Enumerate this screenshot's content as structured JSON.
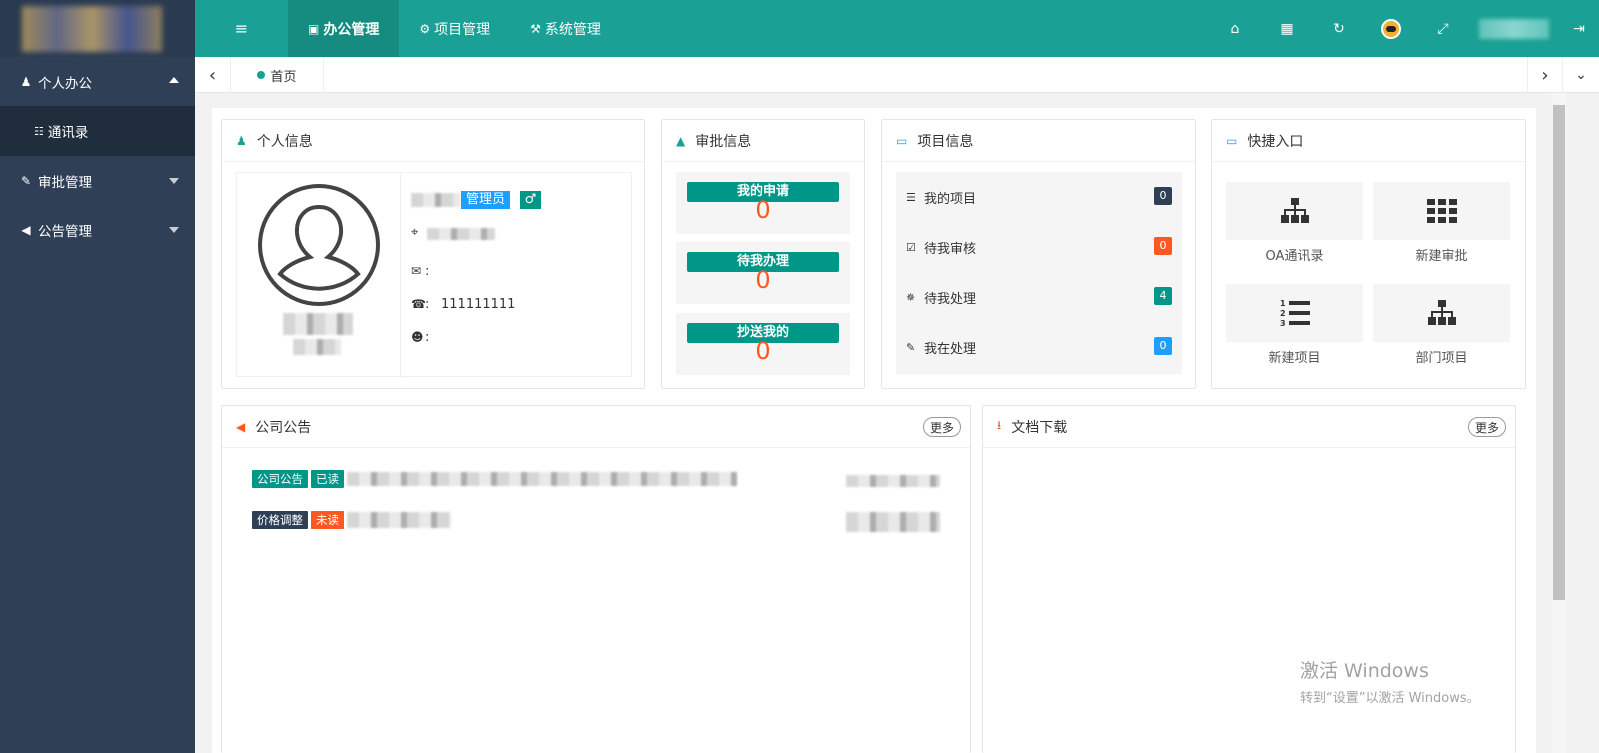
{
  "topbar": {
    "tabs": [
      {
        "label": "办公管理",
        "icon": "briefcase-icon"
      },
      {
        "label": "项目管理",
        "icon": "gears-icon"
      },
      {
        "label": "系统管理",
        "icon": "wrench-icon"
      }
    ],
    "right_icons": [
      "home-icon",
      "grid-icon",
      "refresh-icon",
      "avatar",
      "fullscreen-icon",
      "logout-icon"
    ]
  },
  "sidebar": {
    "items": [
      {
        "label": "个人办公",
        "icon": "user-icon"
      },
      {
        "label": "通讯录",
        "icon": "sitemap-icon"
      },
      {
        "label": "审批管理",
        "icon": "edit-icon"
      },
      {
        "label": "公告管理",
        "icon": "bullhorn-icon"
      }
    ]
  },
  "tabsbar": {
    "home_tab": "首页"
  },
  "personal": {
    "title": "个人信息",
    "role": "管理员",
    "gender_symbol": "♂",
    "email_label": ":",
    "phone_label": ":",
    "phone": "111111111",
    "qq_label": ":"
  },
  "approval": {
    "title": "审批信息",
    "items": [
      {
        "label": "我的申请",
        "value": "0"
      },
      {
        "label": "待我办理",
        "value": "0"
      },
      {
        "label": "抄送我的",
        "value": "0"
      }
    ]
  },
  "project": {
    "title": "项目信息",
    "rows": [
      {
        "label": "我的项目",
        "count": "0",
        "color": "#2f4056"
      },
      {
        "label": "待我审核",
        "count": "0",
        "color": "#ff5722"
      },
      {
        "label": "待我处理",
        "count": "4",
        "color": "#009688"
      },
      {
        "label": "我在处理",
        "count": "0",
        "color": "#1e9fff"
      }
    ]
  },
  "quick": {
    "title": "快捷入口",
    "items": [
      {
        "label": "OA通讯录",
        "icon": "sitemap-icon"
      },
      {
        "label": "新建审批",
        "icon": "grid-icon"
      },
      {
        "label": "新建项目",
        "icon": "ordered-list-icon"
      },
      {
        "label": "部门项目",
        "icon": "sitemap-icon"
      }
    ]
  },
  "notices": {
    "title": "公司公告",
    "more": "更多",
    "rows": [
      {
        "type": "公司公告",
        "type_color": "#009688",
        "status": "已读",
        "status_color": "#009688"
      },
      {
        "type": "价格调整",
        "type_color": "#2f4056",
        "status": "未读",
        "status_color": "#ff5722"
      }
    ]
  },
  "downloads": {
    "title": "文档下载",
    "more": "更多"
  },
  "watermark": {
    "line1": "激活 Windows",
    "line2": "转到“设置”以激活 Windows。"
  }
}
